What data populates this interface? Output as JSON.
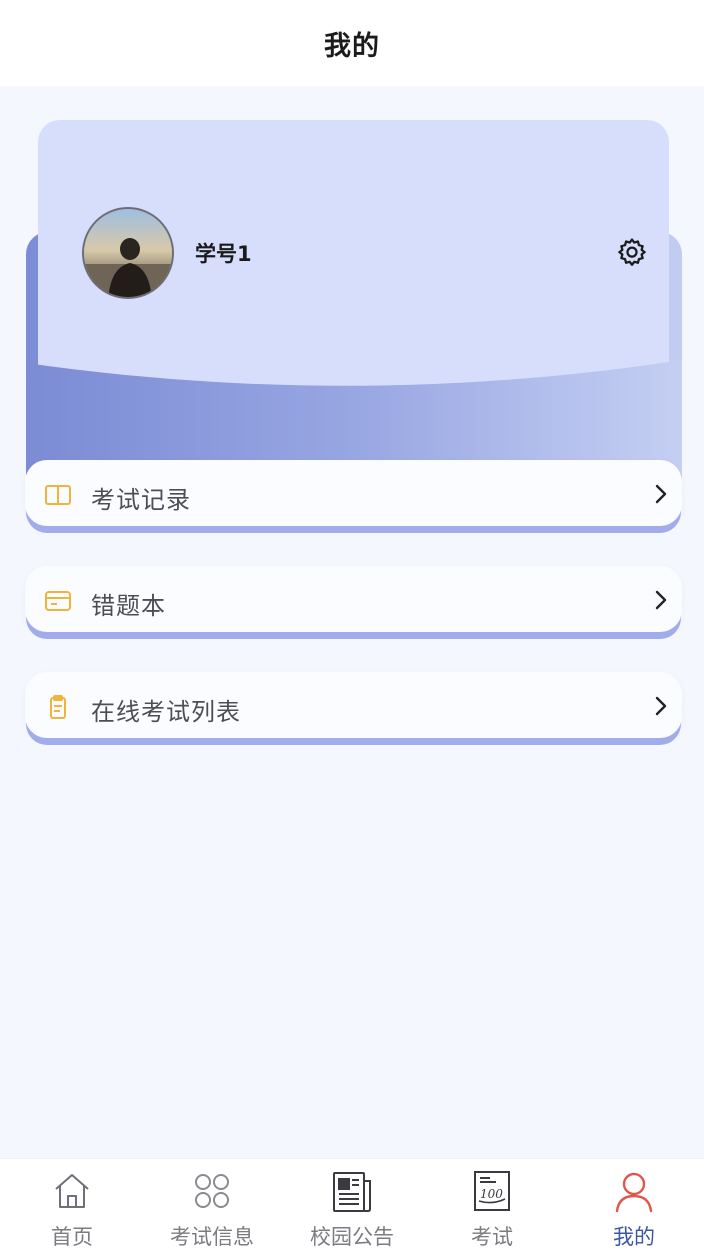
{
  "header": {
    "title": "我的"
  },
  "profile": {
    "name": "学号1",
    "settings_icon": "gear-icon"
  },
  "menu": [
    {
      "label": "考试记录",
      "icon": "book-icon"
    },
    {
      "label": "错题本",
      "icon": "card-icon"
    },
    {
      "label": "在线考试列表",
      "icon": "clipboard-icon"
    }
  ],
  "tabbar": {
    "active_index": 4,
    "tabs": [
      {
        "label": "首页",
        "icon": "home-icon"
      },
      {
        "label": "考试信息",
        "icon": "four-circles-icon"
      },
      {
        "label": "校园公告",
        "icon": "newspaper-icon"
      },
      {
        "label": "考试",
        "icon": "exam-paper-icon"
      },
      {
        "label": "我的",
        "icon": "user-icon"
      }
    ]
  },
  "colors": {
    "accent": "#3d57a6",
    "card_front": "#d6defb",
    "card_back": "#7c8dd6",
    "menu_icon": "#f0b43c",
    "active_tab": "#e0564b",
    "bottom_border": "#a3acea"
  }
}
